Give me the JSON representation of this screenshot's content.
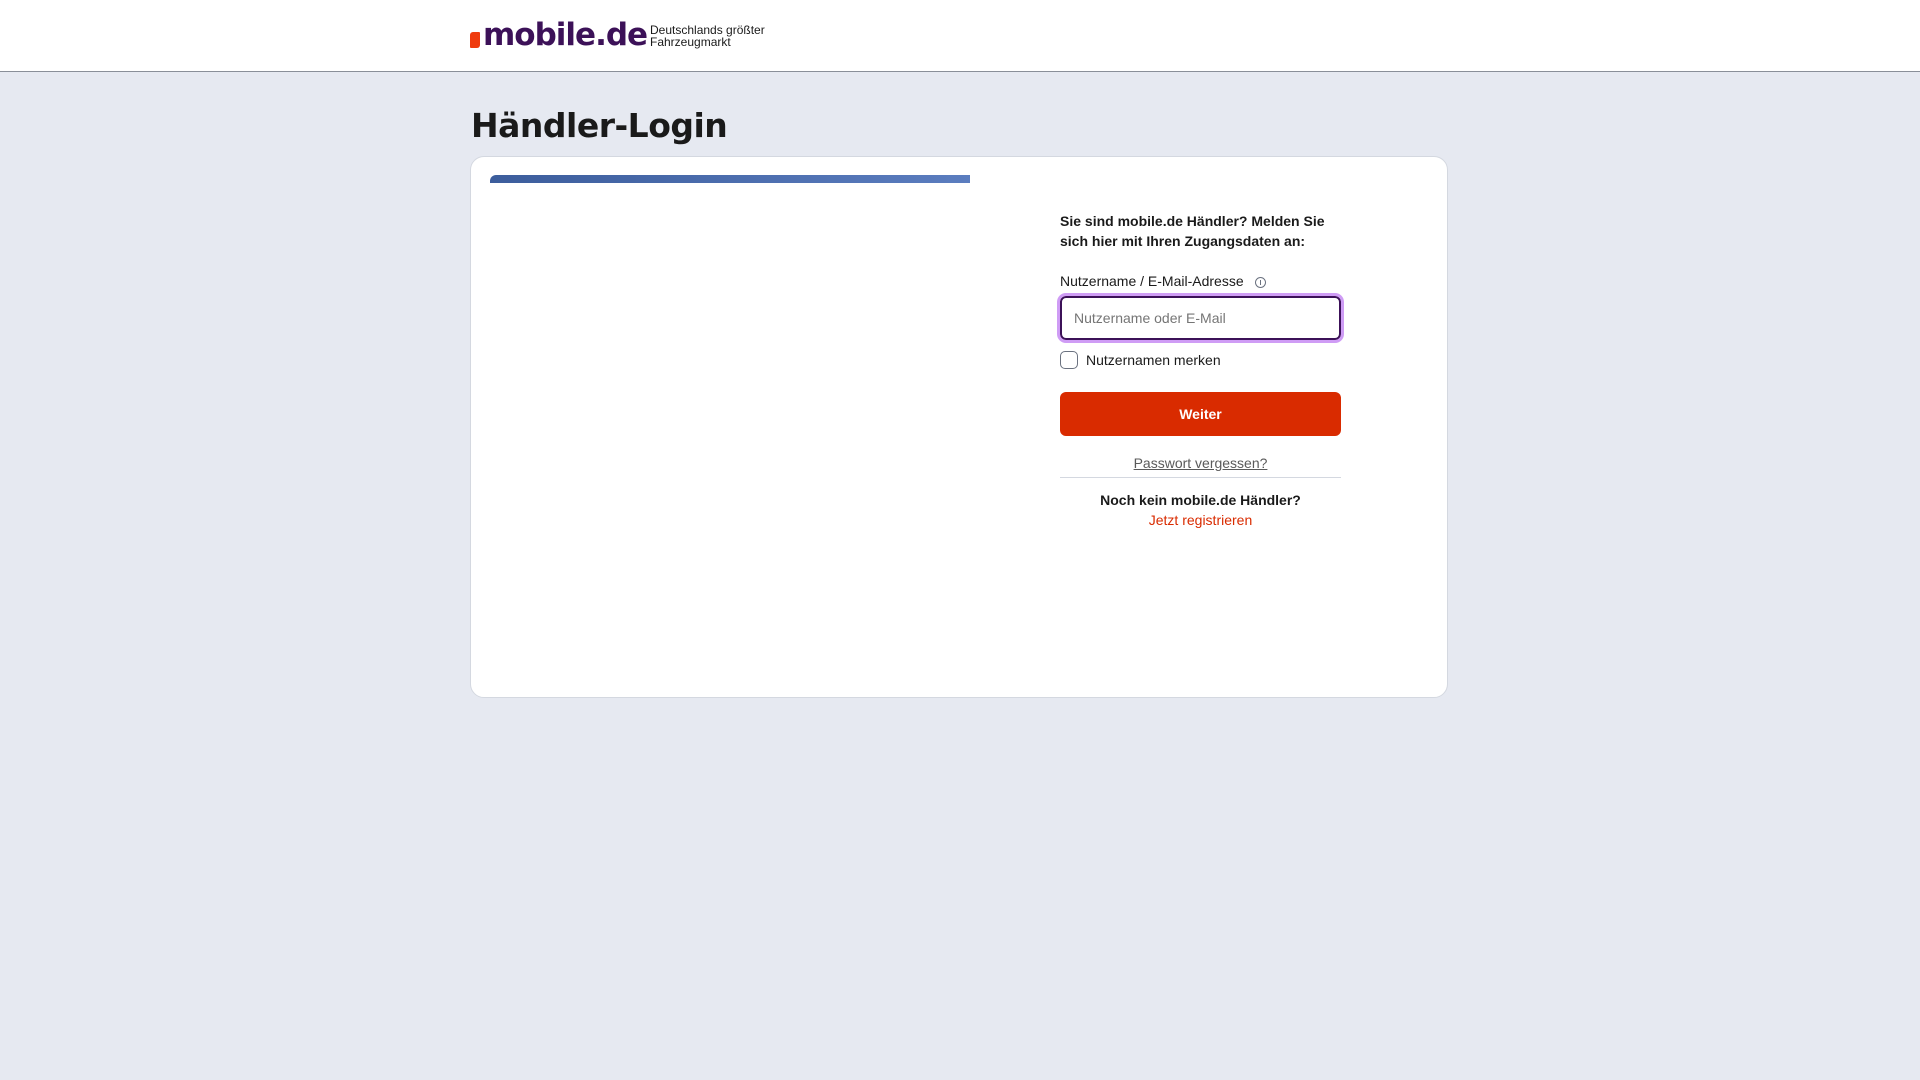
{
  "header": {
    "logo_text": "mobile.de",
    "tagline_line1": "Deutschlands größter",
    "tagline_line2": "Fahrzeugmarkt"
  },
  "page": {
    "title": "Händler-Login"
  },
  "form": {
    "intro": "Sie sind mobile.de Händler? Melden Sie sich hier mit Ihren Zugangsdaten an:",
    "username_label": "Nutzername / E-Mail-Adresse",
    "username_placeholder": "Nutzername oder E-Mail",
    "username_value": "",
    "remember_label": "Nutzernamen merken",
    "submit_label": "Weiter",
    "forgot_label": "Passwort vergessen?",
    "no_dealer_text": "Noch kein mobile.de Händler?",
    "register_label": "Jetzt registrieren"
  },
  "colors": {
    "brand": "#3c1158",
    "accent": "#d92b00",
    "logo_mark": "#ef3b0e",
    "focus_ring": "#cf9cf5",
    "background": "#e6e9f1"
  }
}
